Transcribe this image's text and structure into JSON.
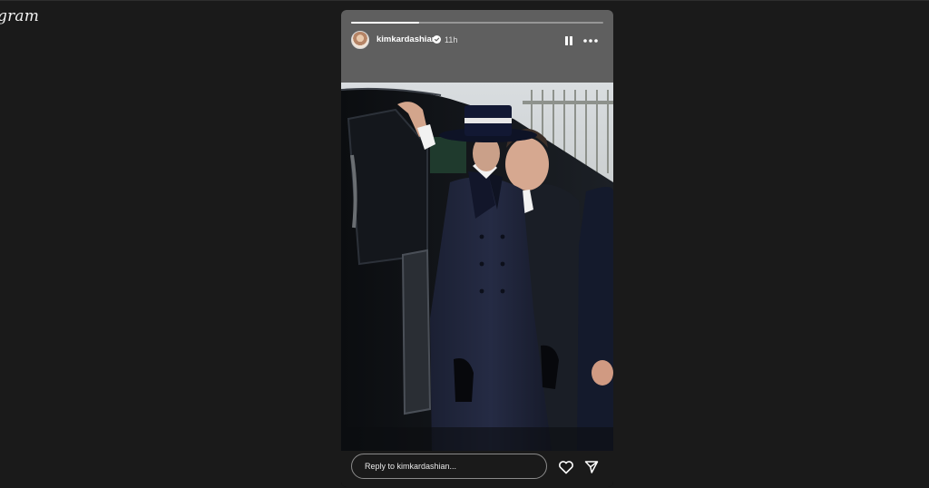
{
  "app": {
    "logo_text": "gram"
  },
  "story": {
    "username": "kimkardashian",
    "time_ago": "11h",
    "progress": 0.27,
    "verified": true,
    "icons": {
      "avatar": "profile-avatar",
      "verified": "verified-badge-icon",
      "pause": "pause-icon",
      "more": "more-options-icon",
      "like": "heart-icon",
      "share": "send-icon"
    }
  },
  "reply": {
    "placeholder": "Reply to kimkardashian..."
  },
  "colors": {
    "background": "#1a1a1a",
    "header_bar": "#5f5f5f",
    "text": "#ffffff"
  }
}
